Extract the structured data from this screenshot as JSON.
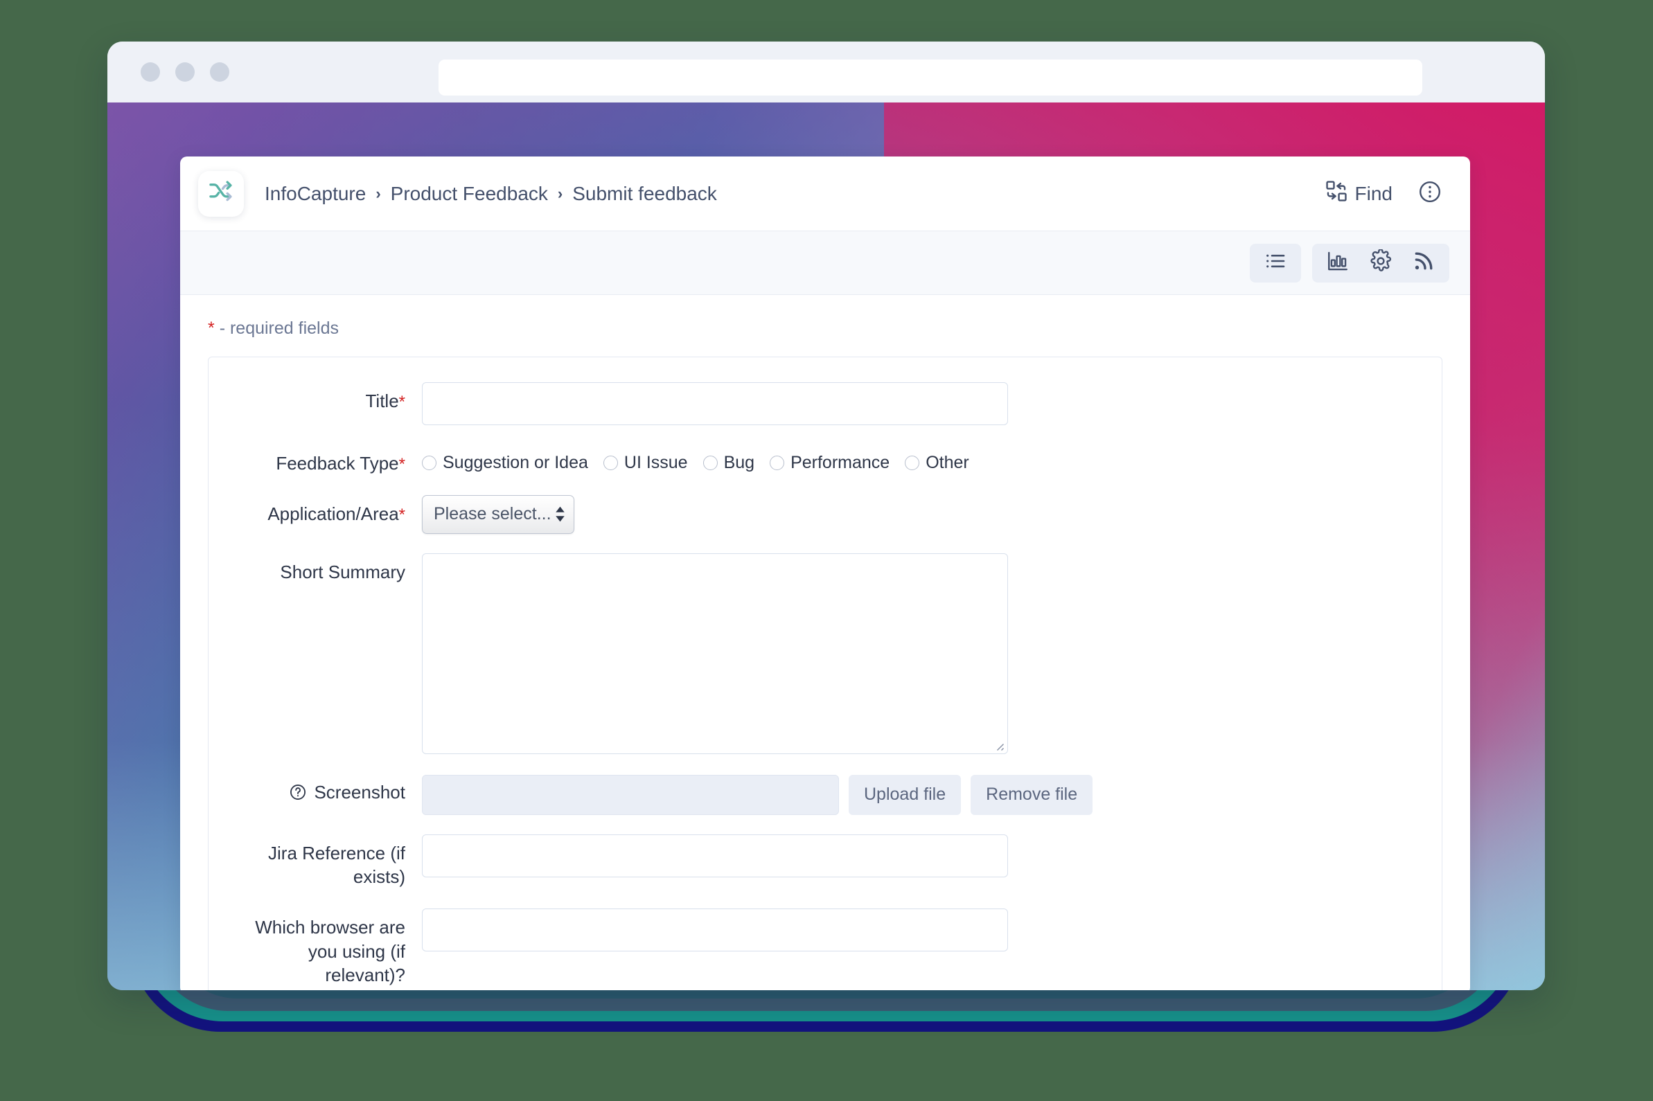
{
  "browser": {
    "url_value": "",
    "url_placeholder": "",
    "traffic_lights": [
      "close",
      "minimize",
      "maximize"
    ]
  },
  "app": {
    "logo_icon": "shuffle-icon",
    "breadcrumb": [
      {
        "label": "InfoCapture"
      },
      {
        "label": "Product Feedback"
      },
      {
        "label": "Submit feedback"
      }
    ],
    "breadcrumb_separator": "›",
    "header_actions": {
      "find_label": "Find",
      "find_icon": "swap-boxes-icon",
      "more_icon": "more-vertical-circle-icon"
    },
    "toolbar_buttons": [
      {
        "name": "list-view-button",
        "icon": "list-icon"
      },
      {
        "name": "reports-button",
        "icon": "bar-chart-icon"
      },
      {
        "name": "settings-button",
        "icon": "gear-icon"
      },
      {
        "name": "feed-button",
        "icon": "rss-icon"
      }
    ]
  },
  "form": {
    "required_note": "- required fields",
    "required_marker": "*",
    "fields": {
      "title": {
        "label": "Title",
        "required": true,
        "value": "",
        "placeholder": ""
      },
      "feedback_type": {
        "label": "Feedback Type",
        "required": true,
        "options": [
          "Suggestion or Idea",
          "UI Issue",
          "Bug",
          "Performance",
          "Other"
        ],
        "selected": ""
      },
      "application_area": {
        "label": "Application/Area",
        "required": true,
        "selected": "Please select..."
      },
      "short_summary": {
        "label": "Short Summary",
        "required": false,
        "value": "",
        "placeholder": ""
      },
      "screenshot": {
        "label": "Screenshot",
        "help_icon": "help-circle-icon",
        "required": false,
        "file_value": "",
        "upload_label": "Upload file",
        "remove_label": "Remove file"
      },
      "jira_reference": {
        "label": "Jira Reference (if exists)",
        "required": false,
        "value": "",
        "placeholder": ""
      },
      "browser_used": {
        "label": "Which browser are you using (if relevant)?",
        "required": false,
        "value": "",
        "placeholder": ""
      }
    }
  },
  "colors": {
    "required_red": "#d32020",
    "brand_teal": "#57b3a6",
    "text_dark": "#2e3648",
    "text_muted": "#6b7793",
    "toolbar_bg": "#eaeef6",
    "gradient_purple": "#7d5aa6",
    "gradient_blue": "#3b6ca8",
    "gradient_pink": "#d71f63",
    "gradient_lightblue": "#9ec9dd",
    "deco_navy": "#13137e",
    "deco_teal": "#17918a",
    "deco_slate": "#3d5a71",
    "page_bg": "#45684a"
  }
}
